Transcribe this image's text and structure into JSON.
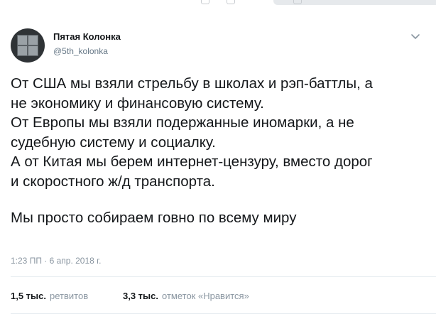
{
  "author": {
    "display_name": "Пятая Колонка",
    "handle": "@5th_kolonka"
  },
  "tweet": {
    "lines": [
      "От США мы взяли стрельбу в школах и рэп-баттлы, а",
      "не экономику и финансовую систему.",
      "От Европы мы взяли подержанные иномарки, а не",
      "судебную систему и социалку.",
      "А от Китая мы берем интернет-цензуру, вместо дорог",
      "и скоростного ж/д транспорта."
    ],
    "closing_line": "Мы просто собираем говно по всему миру",
    "timestamp": "1:23 ПП · 6 апр. 2018 г."
  },
  "stats": {
    "retweets_count": "1,5 тыс.",
    "retweets_label": "ретвитов",
    "likes_count": "3,3 тыс.",
    "likes_label": "отметок «Нравится»"
  },
  "icons": {
    "menu": "chevron-down-icon"
  },
  "colors": {
    "text": "#14171a",
    "secondary": "#657786",
    "divider": "#e6ecf0"
  }
}
